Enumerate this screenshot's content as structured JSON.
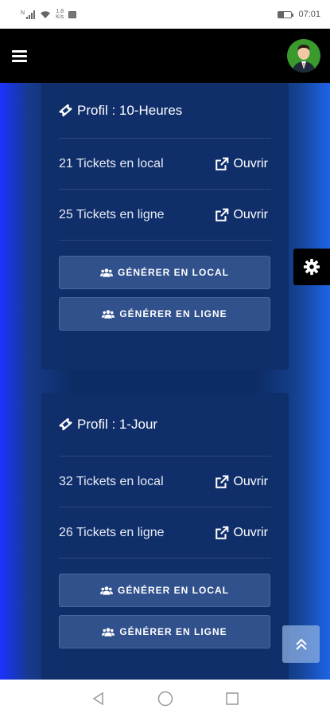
{
  "status_bar": {
    "network": "N",
    "speed_value": "1.8",
    "speed_unit": "K/s",
    "time": "07:01"
  },
  "header": {
    "menu_icon": "hamburger-icon",
    "avatar_icon": "user-avatar"
  },
  "cards": [
    {
      "title": "Profil : 10-Heures",
      "local_text": "21 Tickets en local",
      "online_text": "25 Tickets en ligne",
      "open_label": "Ouvrir",
      "btn_local": "GÉNÉRER EN LOCAL",
      "btn_online": "GÉNÉRER EN LIGNE"
    },
    {
      "title": "Profil : 1-Jour",
      "local_text": "32 Tickets en local",
      "online_text": "26 Tickets en ligne",
      "open_label": "Ouvrir",
      "btn_local": "GÉNÉRER EN LOCAL",
      "btn_online": "GÉNÉRER EN LIGNE"
    }
  ],
  "colors": {
    "header_bg": "#000000",
    "card_bg": "#0f2f6a",
    "accent_blue": "#1a33ff"
  },
  "floating": {
    "settings_icon": "gear-icon",
    "scroll_top_icon": "double-chevron-up-icon"
  },
  "nav_bar": {
    "back_icon": "triangle-back-icon",
    "home_icon": "circle-home-icon",
    "recents_icon": "square-recents-icon"
  }
}
